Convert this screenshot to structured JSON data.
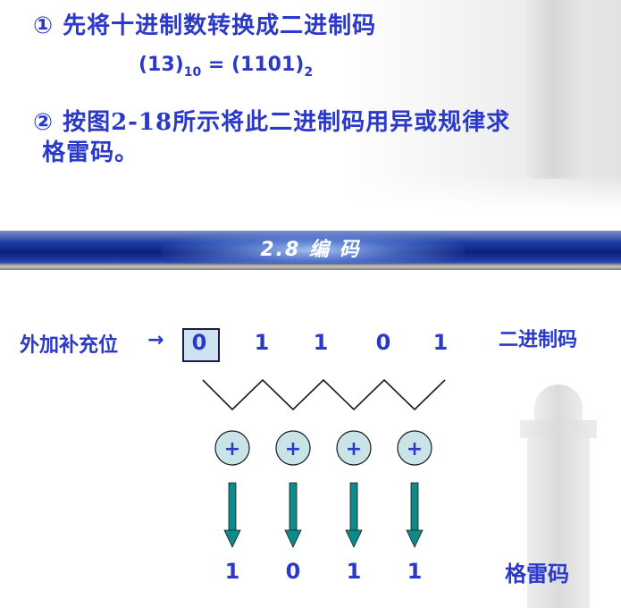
{
  "top": {
    "line1": "① 先将十进制数转换成二进制码",
    "formula": {
      "left": "(13)",
      "left_sub": "10",
      "equals": " = ",
      "right": "(1101)",
      "right_sub": "2"
    },
    "line3_prefix": "②  按图",
    "line3_ref": "2-18",
    "line3_rest": "所示将此二进制码用异或规律求",
    "line3_cont": "格雷码。"
  },
  "banner": {
    "title": "2.8  编 码"
  },
  "diagram": {
    "left_label": "外加补充位",
    "left_arrow": "→",
    "binary_label": "二进制码",
    "gray_label": "格雷码",
    "binary_digits": [
      "0",
      "1",
      "1",
      "0",
      "1"
    ],
    "xor_symbol": "+",
    "gray_digits": [
      "1",
      "0",
      "1",
      "1"
    ]
  },
  "colors": {
    "text": "#2b39c8",
    "box_fill": "#cfe2ef",
    "xor_fill": "#c8e4e8",
    "arrow": "#0f8a8a",
    "banner": "#0d1f7a"
  }
}
